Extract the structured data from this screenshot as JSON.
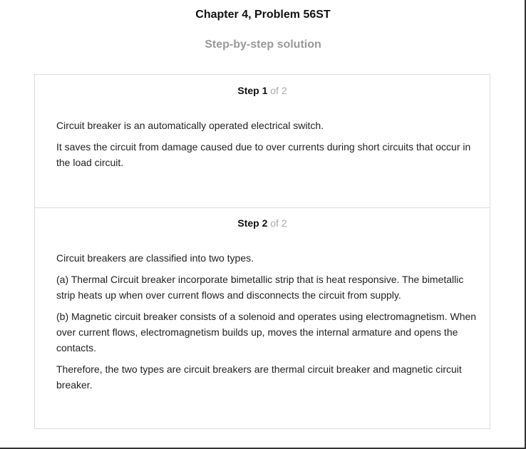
{
  "header": {
    "title": "Chapter 4, Problem 56ST",
    "subtitle": "Step-by-step solution"
  },
  "steps": [
    {
      "label": "Step 1",
      "of": "of 2",
      "paragraphs": [
        "Circuit breaker is an automatically operated electrical switch.",
        "It saves the circuit from damage caused due to over currents during short circuits that occur in the load circuit."
      ]
    },
    {
      "label": "Step 2",
      "of": "of 2",
      "paragraphs": [
        "Circuit breakers are classified into two types.",
        "(a) Thermal Circuit breaker incorporate bimetallic strip that is heat responsive. The bimetallic strip heats up when over current flows and disconnects the circuit from supply.",
        "(b) Magnetic circuit breaker consists of a solenoid and operates using electromagnetism. When over current flows, electromagnetism builds up, moves the internal armature and opens the contacts.",
        "Therefore, the two types are circuit breakers are thermal circuit breaker and magnetic circuit breaker."
      ]
    }
  ]
}
